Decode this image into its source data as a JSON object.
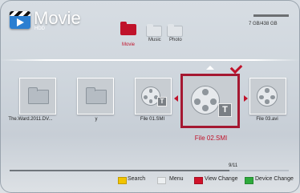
{
  "header": {
    "app_title": "Movie",
    "source": "HDD",
    "storage": "7 GB/438 GB",
    "storage_used_fraction": 0.15
  },
  "tabs": [
    {
      "label": "Movie",
      "selected": true,
      "color": "#c0122a"
    },
    {
      "label": "Music",
      "selected": false,
      "color": "#e0e4e8"
    },
    {
      "label": "Photo",
      "selected": false,
      "color": "#e0e4e8"
    }
  ],
  "files": [
    {
      "label": "The.Ward.2011.DV...",
      "type": "folder"
    },
    {
      "label": "y",
      "type": "folder"
    },
    {
      "label": "File 01.SMI",
      "type": "subtitle"
    },
    {
      "label": "File 02.SMI",
      "type": "subtitle",
      "selected": true
    },
    {
      "label": "File 03.avi",
      "type": "video"
    }
  ],
  "pagination": {
    "text": "9/11",
    "progress": 0.82
  },
  "footer": {
    "buttons": [
      {
        "label": "Search",
        "color": "#f2c400",
        "icon": "yellow-button-icon"
      },
      {
        "label": "Menu",
        "color": "#eceff1",
        "icon": "menu-button-icon"
      },
      {
        "label": "View Change",
        "color": "#d0122a",
        "icon": "red-button-icon"
      },
      {
        "label": "Device Change",
        "color": "#2eaa3c",
        "icon": "green-button-icon"
      }
    ]
  },
  "colors": {
    "accent": "#c0122a",
    "selection_border": "#a51831"
  }
}
